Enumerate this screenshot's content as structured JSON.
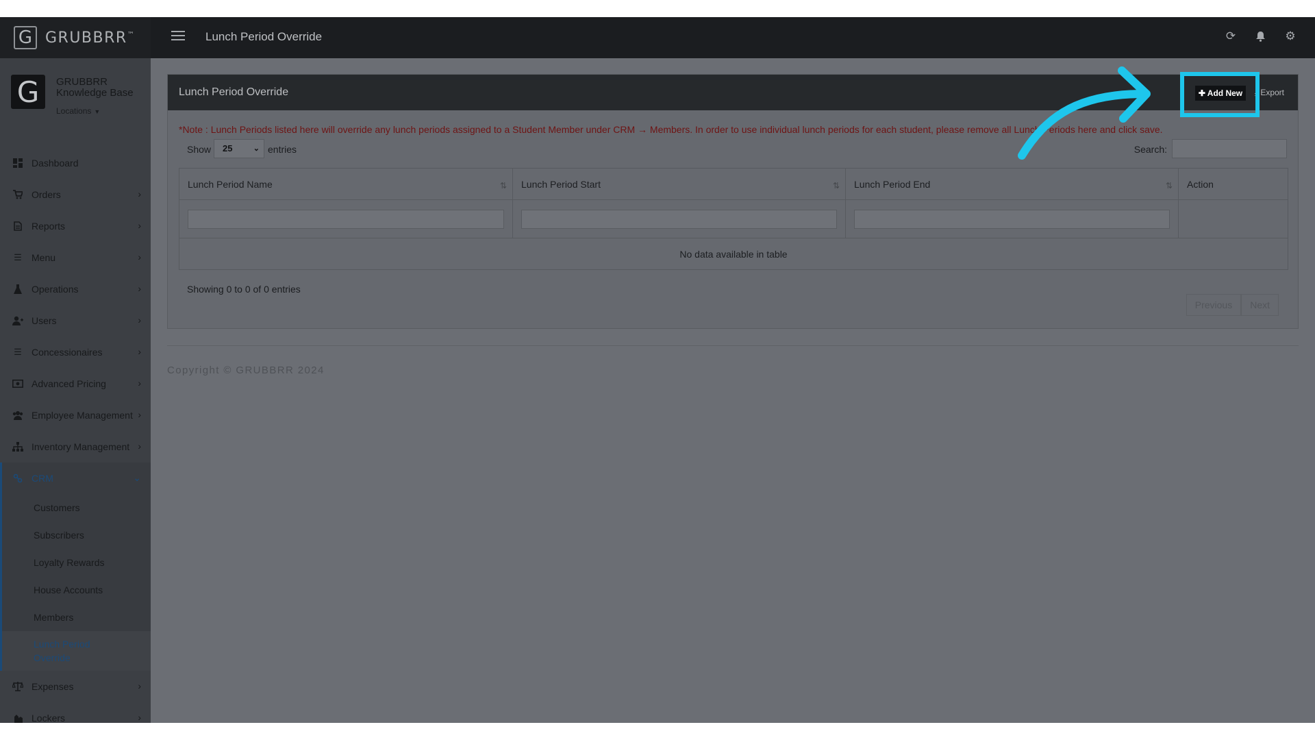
{
  "brand": {
    "logo_letter": "G",
    "name": "GRUBBRR",
    "tm": "™"
  },
  "profile": {
    "avatar_letter": "G",
    "name": "GRUBBRR Knowledge Base",
    "locations_label": "Locations"
  },
  "topbar": {
    "title": "Lunch Period Override"
  },
  "sidebar": {
    "items": [
      {
        "label": "Dashboard",
        "icon": "dashboard-icon"
      },
      {
        "label": "Orders",
        "icon": "cart-icon"
      },
      {
        "label": "Reports",
        "icon": "report-icon"
      },
      {
        "label": "Menu",
        "icon": "menu-list-icon"
      },
      {
        "label": "Operations",
        "icon": "flask-icon"
      },
      {
        "label": "Users",
        "icon": "user-add-icon"
      },
      {
        "label": "Concessionaires",
        "icon": "list-icon"
      },
      {
        "label": "Advanced Pricing",
        "icon": "money-icon"
      },
      {
        "label": "Employee Management",
        "icon": "users-icon"
      },
      {
        "label": "Inventory Management",
        "icon": "sitemap-icon"
      },
      {
        "label": "CRM",
        "icon": "crm-icon"
      },
      {
        "label": "Expenses",
        "icon": "scale-icon"
      },
      {
        "label": "Lockers",
        "icon": "lockers-icon"
      }
    ],
    "crm_sub": [
      "Customers",
      "Subscribers",
      "Loyalty Rewards",
      "House Accounts",
      "Members",
      "Lunch Period Override"
    ]
  },
  "panel": {
    "title": "Lunch Period Override",
    "add_new_label": "Add New",
    "export_label": "Export",
    "note": "*Note : Lunch Periods listed here will override any lunch periods assigned to a Student Member under CRM → Members. In order to use individual lunch periods for each student, please remove all Lunch Periods here and click save.",
    "show_label": "Show",
    "entries_value": "25",
    "entries_label": "entries",
    "search_label": "Search:",
    "columns": [
      "Lunch Period Name",
      "Lunch Period Start",
      "Lunch Period End",
      "Action"
    ],
    "empty_message": "No data available in table",
    "info": "Showing 0 to 0 of 0 entries",
    "previous_label": "Previous",
    "next_label": "Next"
  },
  "footer": {
    "copyright": "Copyright © GRUBBRR 2024"
  },
  "colors": {
    "annotation": "#1ec6ec",
    "active_nav": "#1b4a78",
    "note_text": "#6e1414"
  }
}
